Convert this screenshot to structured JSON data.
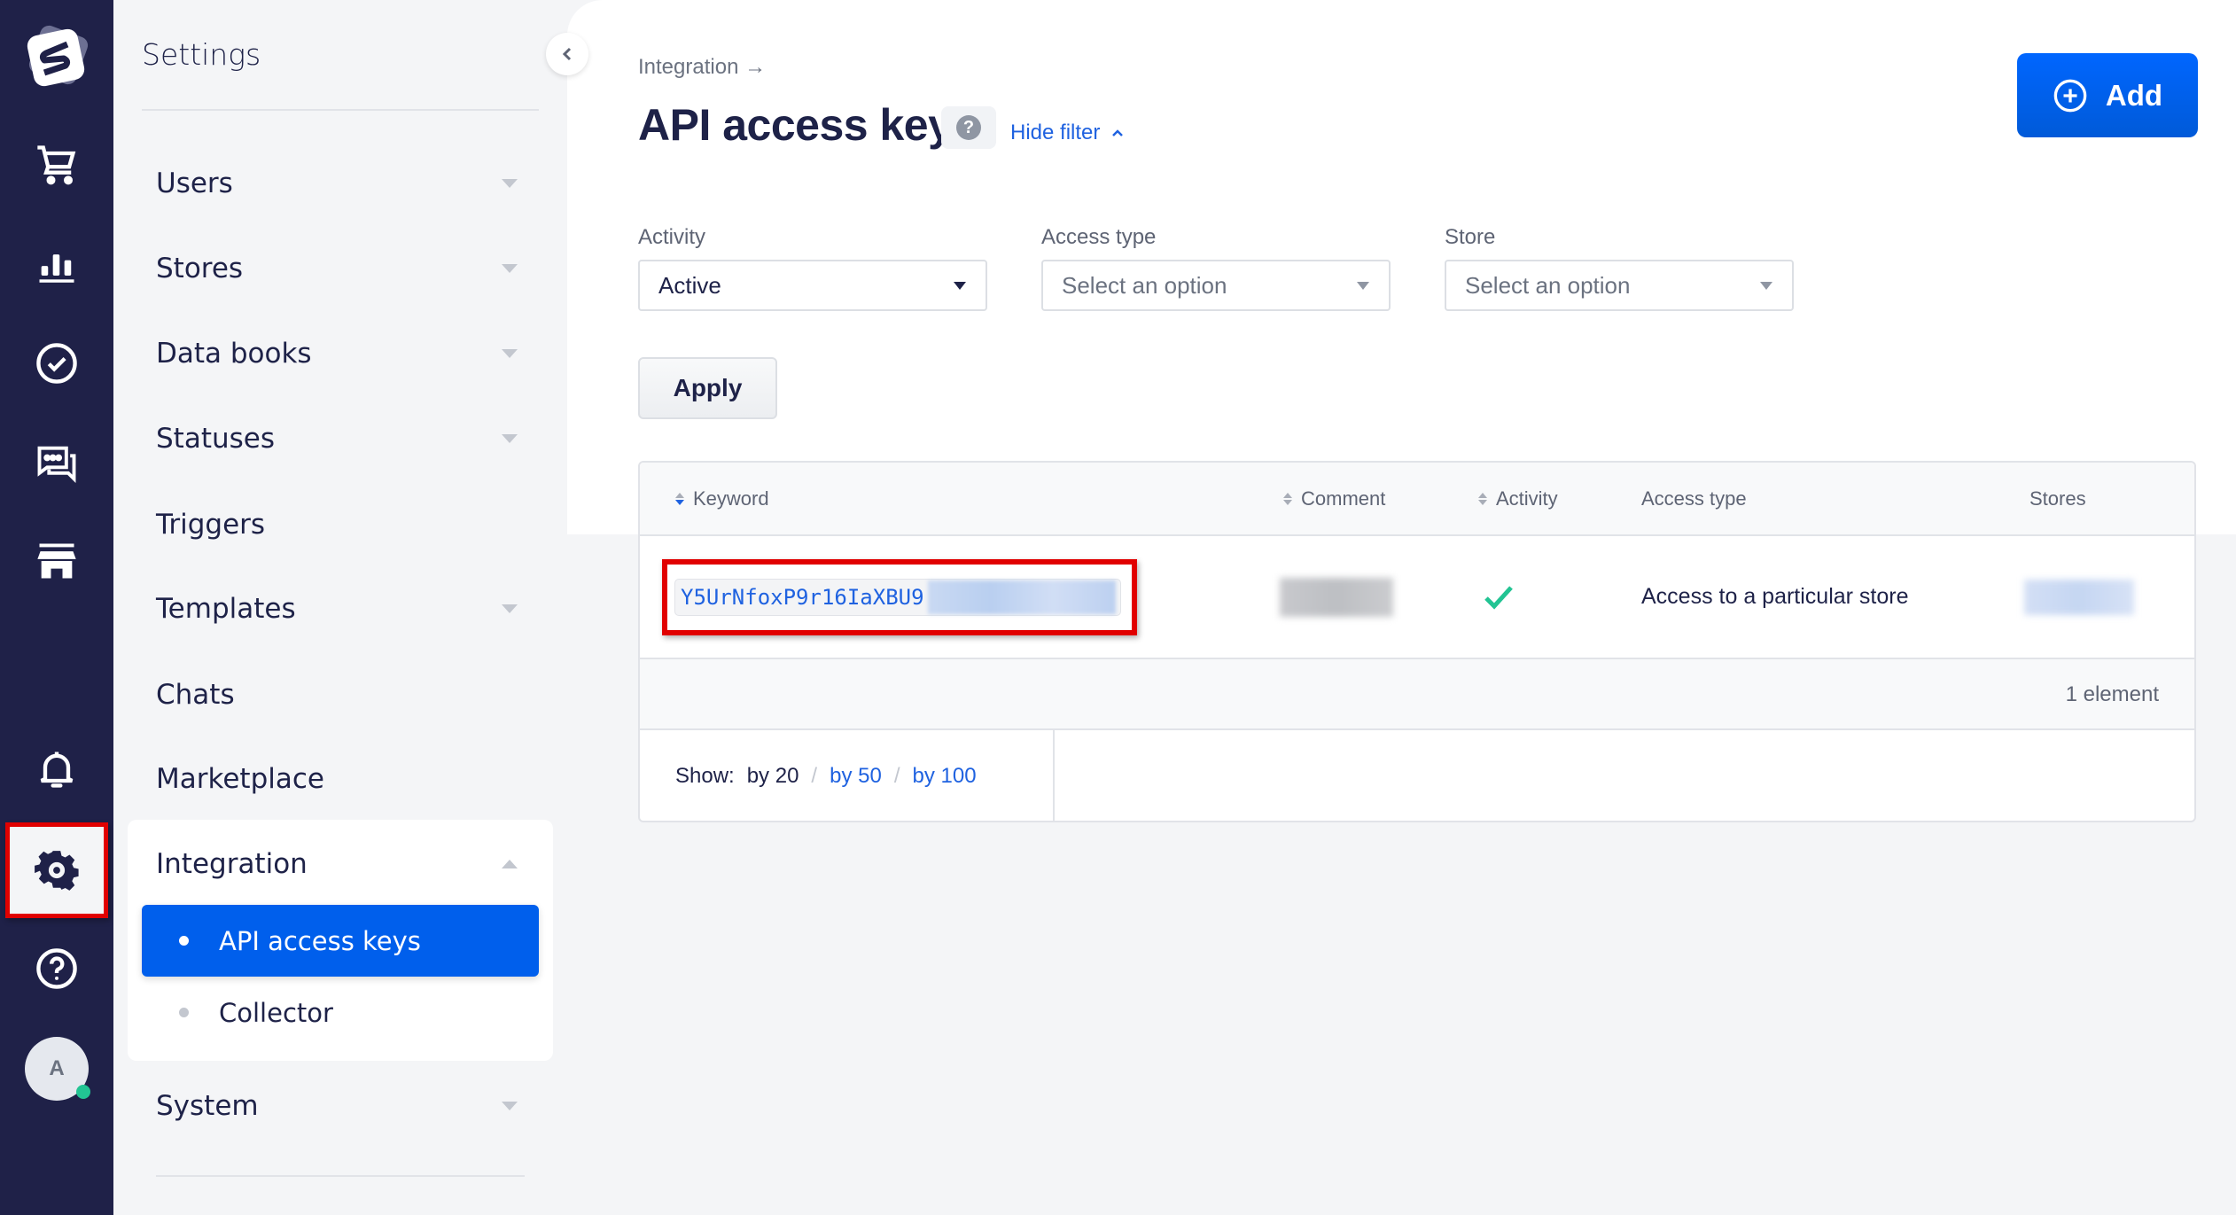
{
  "rail": {
    "items": [
      {
        "name": "orders",
        "icon": "cart-icon"
      },
      {
        "name": "analytics",
        "icon": "bar-chart-icon"
      },
      {
        "name": "tasks",
        "icon": "check-circle-icon"
      },
      {
        "name": "chats",
        "icon": "chat-icon"
      },
      {
        "name": "stores",
        "icon": "store-icon"
      }
    ],
    "bottom": [
      {
        "name": "notifications",
        "icon": "bell-icon"
      },
      {
        "name": "settings",
        "icon": "gear-icon",
        "active": true
      },
      {
        "name": "help",
        "icon": "help-circle-icon"
      }
    ],
    "avatar_initial": "A",
    "colors": {
      "bg": "#1f2148",
      "online": "#22c493"
    }
  },
  "sidebar": {
    "title": "Settings",
    "items": [
      {
        "label": "Users",
        "expandable": true
      },
      {
        "label": "Stores",
        "expandable": true
      },
      {
        "label": "Data books",
        "expandable": true
      },
      {
        "label": "Statuses",
        "expandable": true
      },
      {
        "label": "Triggers",
        "expandable": false
      },
      {
        "label": "Templates",
        "expandable": true
      },
      {
        "label": "Chats",
        "expandable": false
      },
      {
        "label": "Marketplace",
        "expandable": false
      },
      {
        "label": "Integration",
        "expandable": true,
        "expanded": true,
        "children": [
          {
            "label": "API access keys",
            "active": true
          },
          {
            "label": "Collector",
            "active": false
          }
        ]
      },
      {
        "label": "System",
        "expandable": true
      }
    ]
  },
  "header": {
    "breadcrumb": "Integration →",
    "title": "API access keys",
    "help_glyph": "?",
    "hide_filter": "Hide filter",
    "add_label": "Add"
  },
  "filters": {
    "activity": {
      "label": "Activity",
      "value": "Active"
    },
    "access_type": {
      "label": "Access type",
      "placeholder": "Select an option"
    },
    "store": {
      "label": "Store",
      "placeholder": "Select an option"
    },
    "apply_label": "Apply"
  },
  "table": {
    "columns": [
      {
        "label": "Keyword",
        "sortable": true,
        "sorted": "desc"
      },
      {
        "label": "Comment",
        "sortable": true
      },
      {
        "label": "Activity",
        "sortable": true
      },
      {
        "label": "Access type",
        "sortable": false
      },
      {
        "label": "Stores",
        "sortable": false
      }
    ],
    "rows": [
      {
        "keyword_visible": "Y5UrNfoxP9r16IaXBU9",
        "keyword_redacted": true,
        "comment_redacted": true,
        "active": true,
        "access_type": "Access to a particular store",
        "stores_redacted": true
      }
    ],
    "count_text": "1 element",
    "pagination": {
      "label": "Show:",
      "current": "by 20",
      "options": [
        "by 50",
        "by 100"
      ],
      "separator": "/"
    }
  },
  "colors": {
    "accent": "#005fec",
    "link": "#1f62e0",
    "success": "#22c493",
    "highlight": "#e10000"
  }
}
